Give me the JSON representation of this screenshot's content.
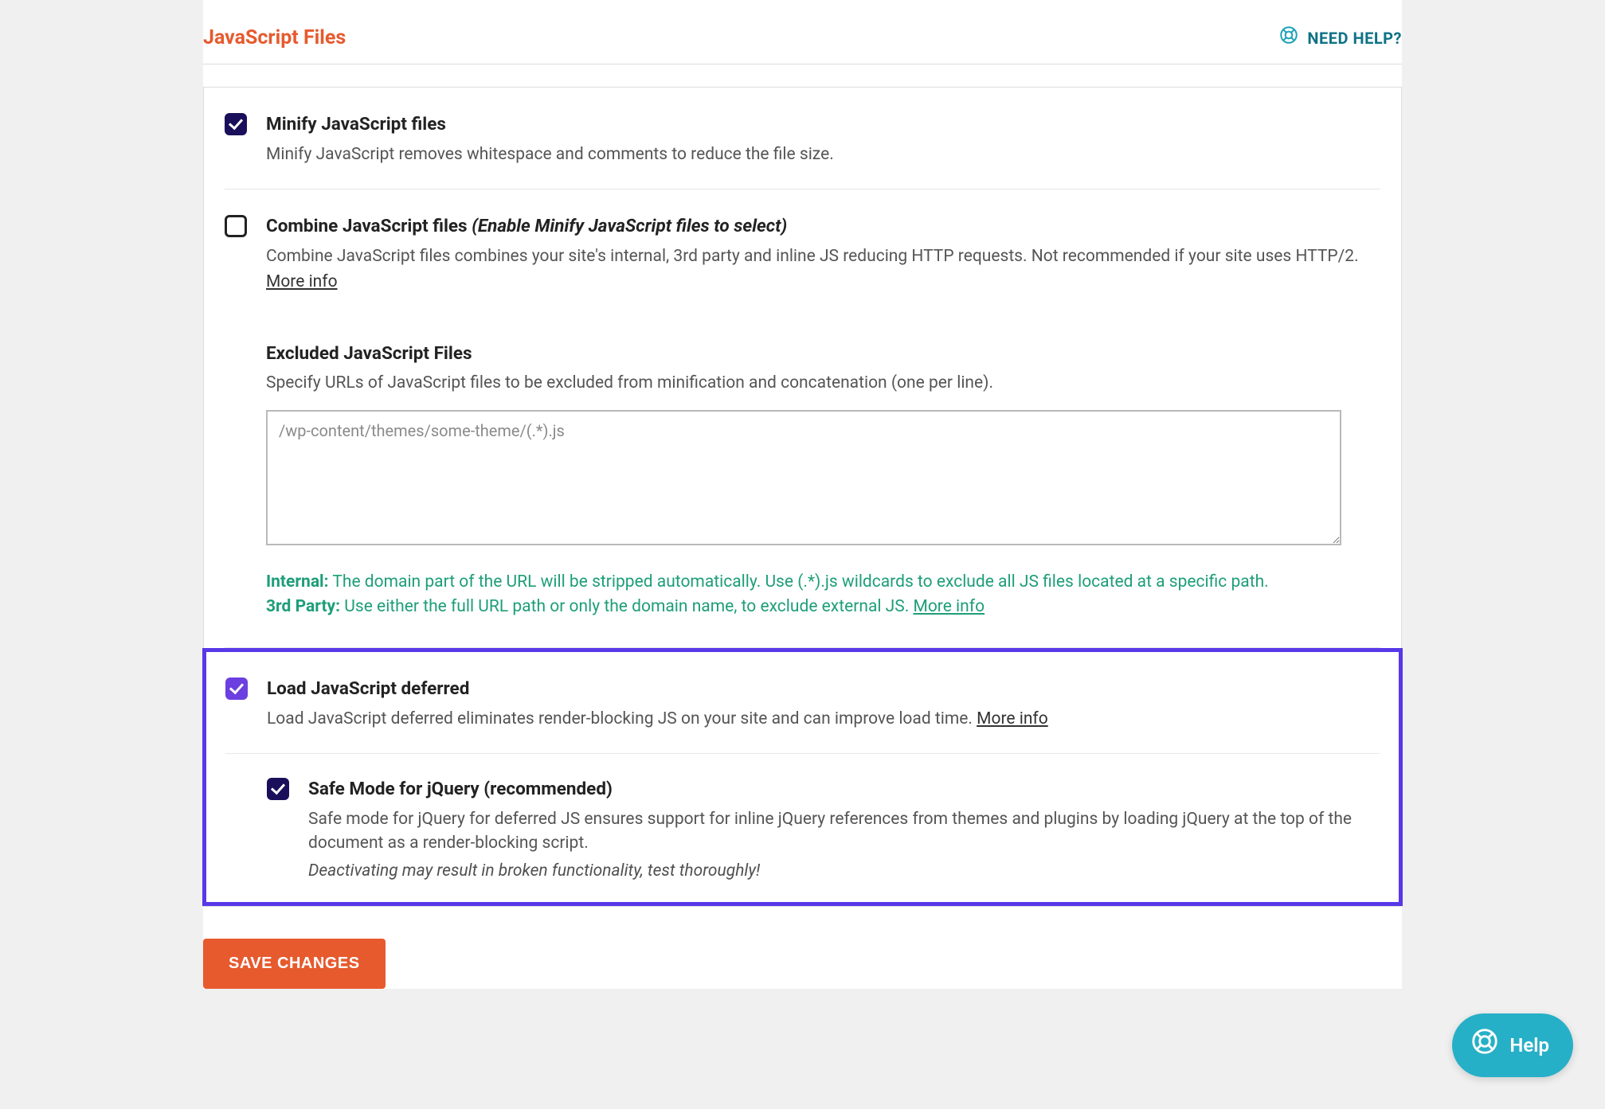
{
  "header": {
    "title": "JavaScript Files",
    "help_label": "NEED HELP?"
  },
  "minify": {
    "title": "Minify JavaScript files",
    "desc": "Minify JavaScript removes whitespace and comments to reduce the file size."
  },
  "combine": {
    "title_main": "Combine JavaScript files",
    "title_hint": "(Enable Minify JavaScript files to select)",
    "desc": "Combine JavaScript files combines your site's internal, 3rd party and inline JS reducing HTTP requests. Not recommended if your site uses HTTP/2.",
    "more": "More info"
  },
  "excluded": {
    "title": "Excluded JavaScript Files",
    "desc": "Specify URLs of JavaScript files to be excluded from minification and concatenation (one per line).",
    "placeholder": "/wp-content/themes/some-theme/(.*).js",
    "note_internal_label": "Internal:",
    "note_internal_text": " The domain part of the URL will be stripped automatically. Use (.*).js wildcards to exclude all JS files located at a specific path.",
    "note_3rd_label": "3rd Party:",
    "note_3rd_text": " Use either the full URL path or only the domain name, to exclude external JS. ",
    "note_more": "More info"
  },
  "defer": {
    "title": "Load JavaScript deferred",
    "desc": "Load JavaScript deferred eliminates render-blocking JS on your site and can improve load time. ",
    "more": "More info"
  },
  "safe_mode": {
    "title": "Safe Mode for jQuery (recommended)",
    "desc": "Safe mode for jQuery for deferred JS ensures support for inline jQuery references from themes and plugins by loading jQuery at the top of the document as a render-blocking script.",
    "warning": "Deactivating may result in broken functionality, test thoroughly!"
  },
  "actions": {
    "save": "SAVE CHANGES"
  },
  "float_help": {
    "label": "Help"
  }
}
